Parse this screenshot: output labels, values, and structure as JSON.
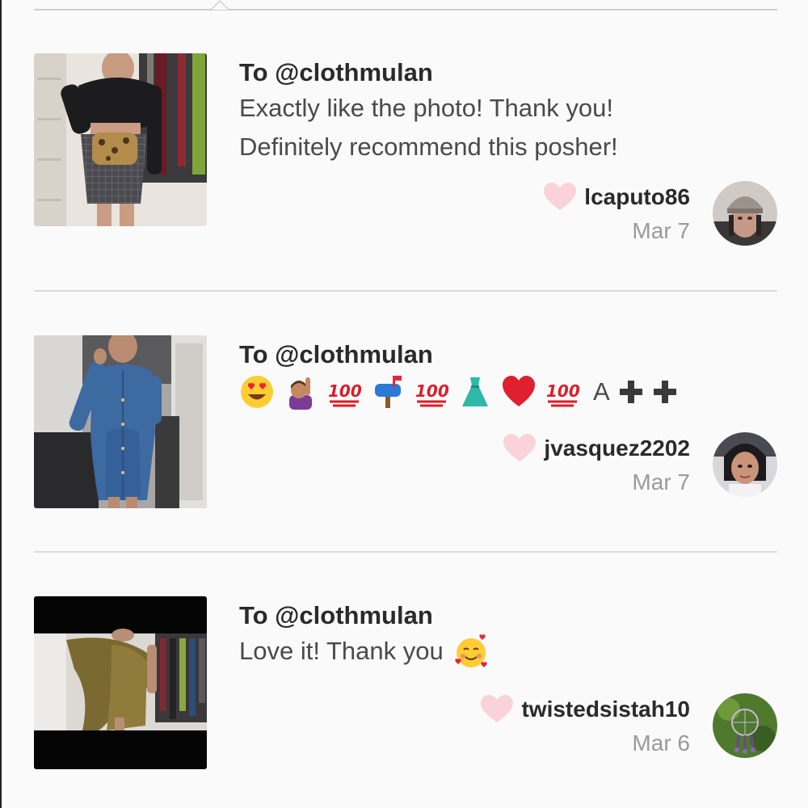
{
  "reviews": [
    {
      "to": "To @clothmulan",
      "comment_lines": [
        "Exactly like the photo! Thank you!",
        "Definitely recommend this posher!"
      ],
      "username": "lcaputo86",
      "date": "Mar 7"
    },
    {
      "to": "To @clothmulan",
      "emoji_text": "A",
      "emojis": [
        "smiling-face-heart-eyes",
        "person-raising-hand",
        "hundred-points",
        "mailbox",
        "hundred-points",
        "dress",
        "red-heart",
        "hundred-points"
      ],
      "username": "jvasquez2202",
      "date": "Mar 7"
    },
    {
      "to": "To @clothmulan",
      "comment": "Love it! Thank you",
      "emoji": "smiling-face-with-hearts",
      "username": "twistedsistah10",
      "date": "Mar 6"
    }
  ],
  "colors": {
    "heart": "#f9d3d9",
    "divider": "#dcdadb",
    "text_dark": "#2a2a2a",
    "text_body": "#4a4a4a",
    "date": "#9a9a9a"
  }
}
